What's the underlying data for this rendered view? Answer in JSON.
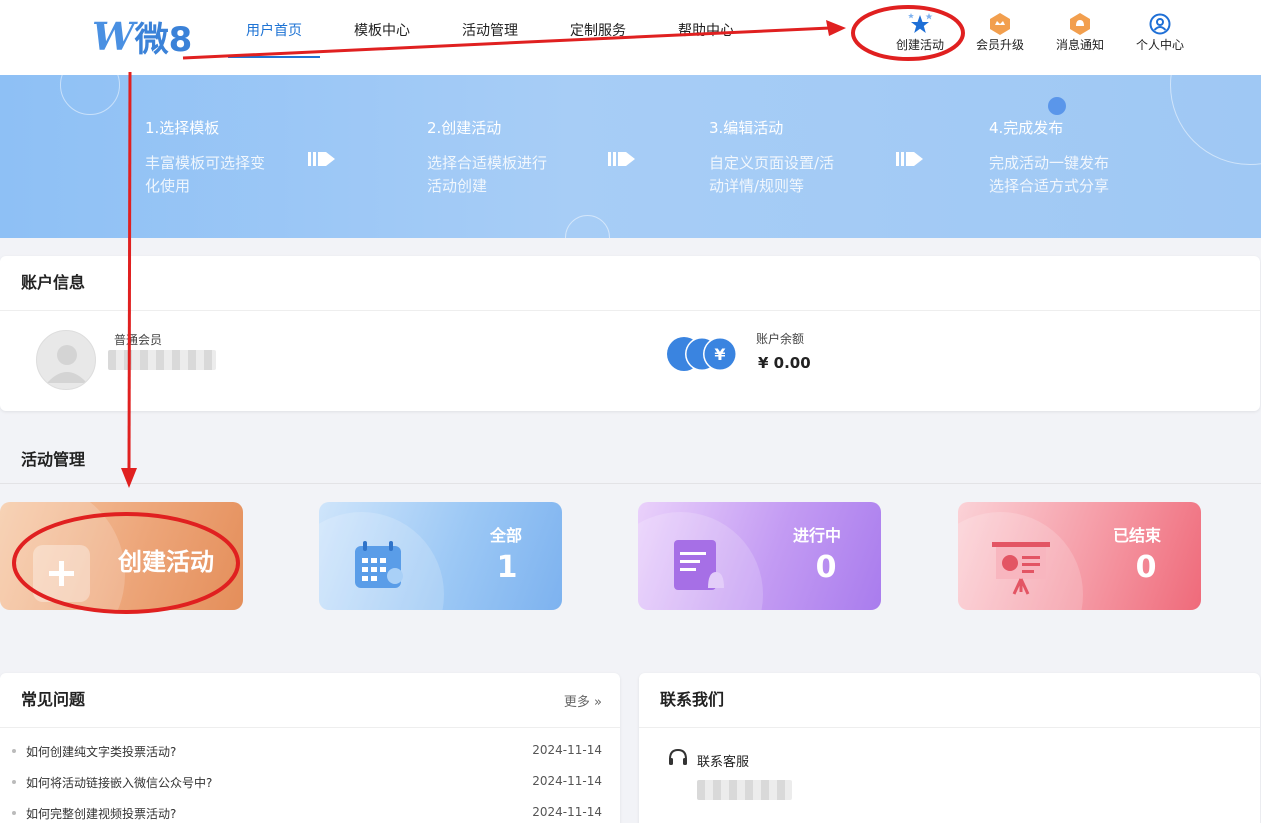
{
  "logo": {
    "text": "微8"
  },
  "nav": [
    {
      "label": "用户首页",
      "active": true
    },
    {
      "label": "模板中心"
    },
    {
      "label": "活动管理"
    },
    {
      "label": "定制服务"
    },
    {
      "label": "帮助中心"
    }
  ],
  "tools": [
    {
      "label": "创建活动",
      "icon": "stars-icon"
    },
    {
      "label": "会员升级",
      "icon": "crown-icon"
    },
    {
      "label": "消息通知",
      "icon": "bell-icon"
    },
    {
      "label": "个人中心",
      "icon": "user-circle-icon"
    }
  ],
  "steps": [
    {
      "title": "1.选择模板",
      "desc": "丰富模板可选择变化使用"
    },
    {
      "title": "2.创建活动",
      "desc": "选择合适模板进行活动创建"
    },
    {
      "title": "3.编辑活动",
      "desc": "自定义页面设置/活动详情/规则等"
    },
    {
      "title": "4.完成发布",
      "desc": "完成活动一键发布选择合适方式分享"
    }
  ],
  "account": {
    "title": "账户信息",
    "member_level": "普通会员",
    "balance_label": "账户余额",
    "balance_value": "¥ 0.00",
    "currency_symbol": "¥"
  },
  "activity": {
    "title": "活动管理",
    "create_label": "创建活动",
    "tiles": [
      {
        "label": "全部",
        "value": "1",
        "color": "#7eb3f2"
      },
      {
        "label": "进行中",
        "value": "0",
        "color": "#b58cf0"
      },
      {
        "label": "已结束",
        "value": "0",
        "color": "#f2707f"
      }
    ]
  },
  "faq": {
    "title": "常见问题",
    "more": "更多 »",
    "items": [
      {
        "q": "如何创建纯文字类投票活动?",
        "date": "2024-11-14"
      },
      {
        "q": "如何将活动链接嵌入微信公众号中?",
        "date": "2024-11-14"
      },
      {
        "q": "如何完整创建视频投票活动?",
        "date": "2024-11-14"
      }
    ]
  },
  "contact": {
    "title": "联系我们",
    "service_label": "联系客服"
  },
  "colors": {
    "primary": "#1e73d4",
    "annotation": "#e02020",
    "create_tile": "#e89a6a"
  }
}
